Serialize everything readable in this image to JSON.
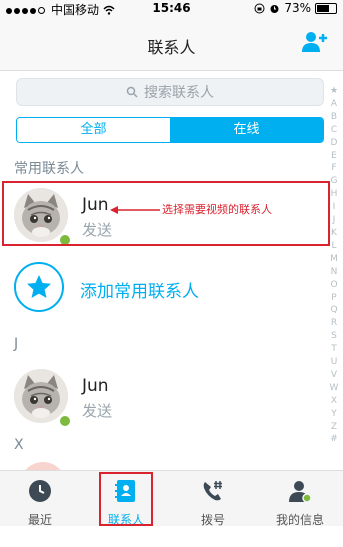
{
  "status_bar": {
    "carrier": "中国移动",
    "time": "15:46",
    "battery": "73%",
    "battery_level": 0.73
  },
  "nav": {
    "title": "联系人",
    "add_icon": "add-contact-icon"
  },
  "search": {
    "placeholder": "搜索联系人",
    "icon": "search-icon"
  },
  "segment": {
    "all": "全部",
    "online": "在线",
    "selected": "online"
  },
  "favorites": {
    "header": "常用联系人",
    "contact": {
      "name": "Jun",
      "status": "发送",
      "avatar": "kitten-avatar"
    }
  },
  "annotation": {
    "text": "选择需要视频的联系人",
    "color": "#d9232f"
  },
  "add_favorite": {
    "label": "添加常用联系人",
    "icon": "star-icon"
  },
  "group_j": {
    "header": "J",
    "contact": {
      "name": "Jun",
      "status": "发送"
    }
  },
  "group_x": {
    "header": "X"
  },
  "index_letters": [
    "★",
    "A",
    "B",
    "C",
    "D",
    "E",
    "F",
    "G",
    "H",
    "I",
    "J",
    "K",
    "L",
    "M",
    "N",
    "O",
    "P",
    "Q",
    "R",
    "S",
    "T",
    "U",
    "V",
    "W",
    "X",
    "Y",
    "Z",
    "#"
  ],
  "tabs": [
    {
      "label": "最近",
      "icon": "clock-icon"
    },
    {
      "label": "联系人",
      "icon": "contacts-icon"
    },
    {
      "label": "拨号",
      "icon": "dialpad-icon"
    },
    {
      "label": "我的信息",
      "icon": "profile-icon"
    }
  ],
  "colors": {
    "accent": "#00aff0",
    "online": "#7cb93c",
    "highlight": "#d9232f"
  }
}
